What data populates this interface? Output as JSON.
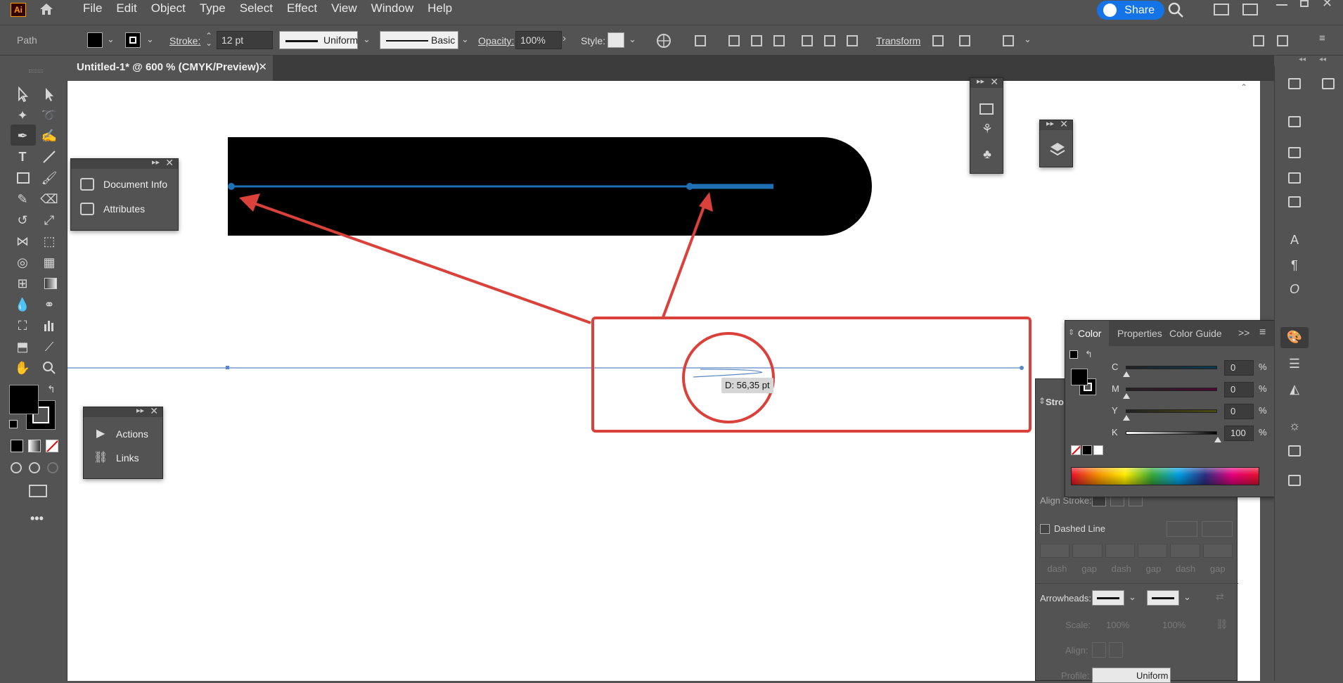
{
  "app": {
    "logo_text": "Ai"
  },
  "menu": [
    "File",
    "Edit",
    "Object",
    "Type",
    "Select",
    "Effect",
    "View",
    "Window",
    "Help"
  ],
  "share_label": "Share",
  "control": {
    "selection_type": "Path",
    "stroke_label": "Stroke:",
    "stroke_value": "12 pt",
    "profile_label": "Uniform",
    "brush_label": "Basic",
    "opacity_label": "Opacity:",
    "opacity_value": "100%",
    "style_label": "Style:",
    "transform_label": "Transform"
  },
  "document_tab": {
    "title": "Untitled-1* @ 600 % (CMYK/Preview)",
    "close": "✕"
  },
  "panels": {
    "info": {
      "items": [
        "Document Info",
        "Attributes"
      ]
    },
    "actions": {
      "items": [
        "Actions",
        "Links"
      ]
    }
  },
  "canvas": {
    "measure_tooltip": "D: 56,35 pt"
  },
  "color_panel": {
    "tabs": [
      "Color",
      "Properties",
      "Color Guide"
    ],
    "channels": [
      {
        "label": "C",
        "value": "0",
        "unit": "%",
        "level": 0
      },
      {
        "label": "M",
        "value": "0",
        "unit": "%",
        "level": 0
      },
      {
        "label": "Y",
        "value": "0",
        "unit": "%",
        "level": 0
      },
      {
        "label": "K",
        "value": "100",
        "unit": "%",
        "level": 1
      }
    ]
  },
  "stroke_panel": {
    "title": "Stro",
    "align_stroke_label": "Align Stroke:",
    "dashed_line_label": "Dashed Line",
    "dash_gap_labels": [
      "dash",
      "gap",
      "dash",
      "gap",
      "dash",
      "gap"
    ],
    "arrowheads_label": "Arrowheads:",
    "scale_label": "Scale:",
    "scale_values": [
      "100%",
      "100%"
    ],
    "align_label": "Align:",
    "profile_label": "Profile:",
    "profile_value": "Uniform"
  },
  "colors": {
    "accent": "#1473e6",
    "annotation": "#d9413a",
    "path_blue": "#1f6fb4"
  }
}
